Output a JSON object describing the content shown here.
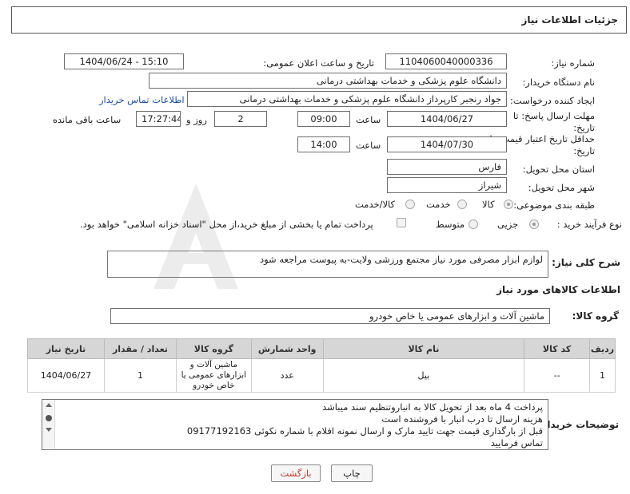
{
  "header": {
    "title": "جزئیات اطلاعات نیاز"
  },
  "form": {
    "need_number": {
      "label": "شماره نیاز:",
      "value": "1104060040000336"
    },
    "announce_datetime": {
      "label": "تاریخ و ساعت اعلان عمومی:",
      "value": "1404/06/24 - 15:10"
    },
    "buyer_org": {
      "label": "نام دستگاه خریدار:",
      "value": "دانشگاه علوم پزشکی و خدمات بهداشتی درمانی"
    },
    "requester": {
      "label": "ایجاد کننده درخواست:",
      "value": "جواد رنجبر کارپرداز دانشگاه علوم پزشکی و خدمات بهداشتی درمانی",
      "contact_link": "اطلاعات تماس خریدار"
    },
    "reply_deadline": {
      "label": "مهلت ارسال پاسخ: تا تاریخ:",
      "date": "1404/06/27",
      "time_label": "ساعت",
      "time": "09:00",
      "days": "2",
      "days_label": "روز و",
      "remaining": "17:27:44",
      "remaining_label": "ساعت باقی مانده"
    },
    "price_validity": {
      "label": "حداقل تاریخ اعتبار قیمت: تا تاریخ:",
      "date": "1404/07/30",
      "time_label": "ساعت",
      "time": "14:00"
    },
    "province": {
      "label": "استان محل تحویل:",
      "value": "فارس"
    },
    "city": {
      "label": "شهر محل تحویل:",
      "value": "شیراز"
    },
    "category": {
      "label": "طبقه بندی موضوعی:",
      "options": [
        "کالا",
        "خدمت",
        "کالا/خدمت"
      ],
      "selected": "کالا"
    },
    "process_type": {
      "label": "نوع فرآیند خرید :",
      "options": [
        "جزیی",
        "متوسط"
      ],
      "selected": "جزیی",
      "payment_note": "پرداخت تمام یا بخشی از مبلغ خرید،از محل \"اسناد خزانه اسلامی\" خواهد بود."
    },
    "description": {
      "label": "شرح کلی نیاز:",
      "value": "لوازم ابزار مصرفی مورد نیاز مجتمع ورزشی ولایت-به پیوست مراجعه شود"
    }
  },
  "goods": {
    "section_title": "اطلاعات کالاهای مورد نیاز",
    "group_label": "گروه کالا:",
    "group_value": "ماشین آلات و ابزارهای عمومی یا خاص خودرو",
    "columns": [
      "ردیف",
      "کد کالا",
      "نام کالا",
      "واحد شمارش",
      "گروه کالا",
      "تعداد / مقدار",
      "تاریخ نیاز"
    ],
    "rows": [
      {
        "row": "1",
        "code": "--",
        "name": "بیل",
        "unit": "عدد",
        "group": "ماشین آلات و ابزارهای عمومی یا خاص خودرو",
        "qty": "1",
        "date": "1404/06/27"
      }
    ]
  },
  "buyer_notes": {
    "label": "توضیحات خریدار:",
    "lines": [
      "پرداخت 4 ماه بعد از تحویل کالا به انبارو‌تنظیم سند میباشد",
      "هزینه ارسال تا درب انبار با فروشنده است",
      "قبل از بارگذاری قیمت جهت تایید مارک و ارسال نمونه اقلام با شماره  نکوئی 09177192163",
      "تماس فرمایید"
    ]
  },
  "buttons": {
    "print": "چاپ",
    "back": "بازگشت"
  },
  "colors": {
    "link": "#1f4fa8",
    "back_text": "#c0392b",
    "header_border": "#555555"
  }
}
